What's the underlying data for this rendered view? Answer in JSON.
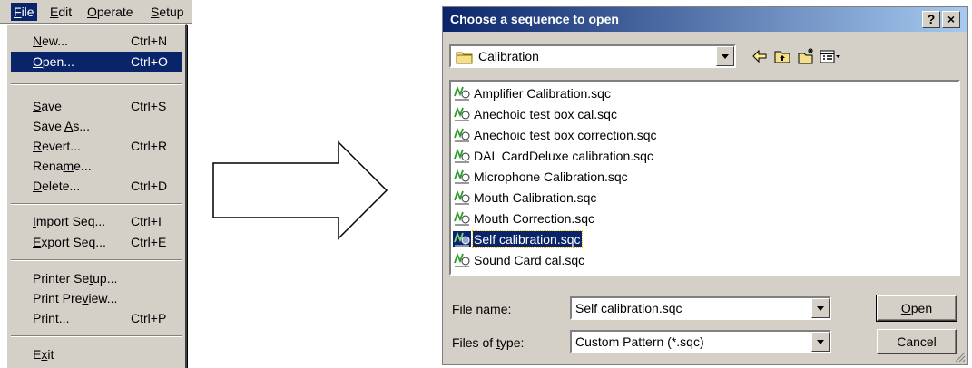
{
  "menubar": {
    "items": [
      {
        "letter": "F",
        "rest": "ile"
      },
      {
        "letter": "E",
        "rest": "dit"
      },
      {
        "letter": "O",
        "rest": "perate"
      },
      {
        "letter": "S",
        "rest": "etup"
      }
    ]
  },
  "file_menu": {
    "items": [
      {
        "pre": "",
        "ul": "N",
        "post": "ew...",
        "shortcut": "Ctrl+N"
      },
      {
        "pre": "",
        "ul": "O",
        "post": "pen...",
        "shortcut": "Ctrl+O"
      },
      {
        "pre": "",
        "ul": "S",
        "post": "ave",
        "shortcut": "Ctrl+S"
      },
      {
        "pre": "Save ",
        "ul": "A",
        "post": "s...",
        "shortcut": ""
      },
      {
        "pre": "",
        "ul": "R",
        "post": "evert...",
        "shortcut": "Ctrl+R"
      },
      {
        "pre": "Rena",
        "ul": "m",
        "post": "e...",
        "shortcut": ""
      },
      {
        "pre": "",
        "ul": "D",
        "post": "elete...",
        "shortcut": "Ctrl+D"
      },
      {
        "pre": "",
        "ul": "I",
        "post": "mport Seq...",
        "shortcut": "Ctrl+I"
      },
      {
        "pre": "",
        "ul": "E",
        "post": "xport Seq...",
        "shortcut": "Ctrl+E"
      },
      {
        "pre": "Printer Se",
        "ul": "t",
        "post": "up...",
        "shortcut": ""
      },
      {
        "pre": "Print Pre",
        "ul": "v",
        "post": "iew...",
        "shortcut": ""
      },
      {
        "pre": "",
        "ul": "P",
        "post": "rint...",
        "shortcut": "Ctrl+P"
      },
      {
        "pre": "E",
        "ul": "x",
        "post": "it",
        "shortcut": ""
      }
    ]
  },
  "dialog": {
    "title": "Choose a sequence to open",
    "title_buttons": {
      "help": "?",
      "close": "×"
    },
    "look_in": "Calibration",
    "files": [
      "Amplifier Calibration.sqc",
      "Anechoic test box cal.sqc",
      "Anechoic test box correction.sqc",
      "DAL CardDeluxe calibration.sqc",
      "Microphone Calibration.sqc",
      "Mouth Calibration.sqc",
      "Mouth Correction.sqc",
      "Self calibration.sqc",
      "Sound Card cal.sqc"
    ],
    "file_name_label": {
      "pre": "File ",
      "ul": "n",
      "post": "ame:"
    },
    "file_name_value": "Self calibration.sqc",
    "file_type_label": {
      "pre": "Files of ",
      "ul": "t",
      "post": "ype:"
    },
    "file_type_value": "Custom Pattern (*.sqc)",
    "open_button": {
      "pre": "",
      "ul": "O",
      "post": "pen"
    },
    "cancel_button": "Cancel"
  },
  "colors": {
    "selection": "#0a246a",
    "face": "#d4d0c8",
    "title_gradient_end": "#a6caf0"
  },
  "icons": {
    "back": "back-arrow-icon",
    "up": "up-folder-icon",
    "new_folder": "new-folder-icon",
    "view_menu": "view-menu-icon",
    "file": "sequence-file-icon",
    "folder": "folder-icon"
  }
}
